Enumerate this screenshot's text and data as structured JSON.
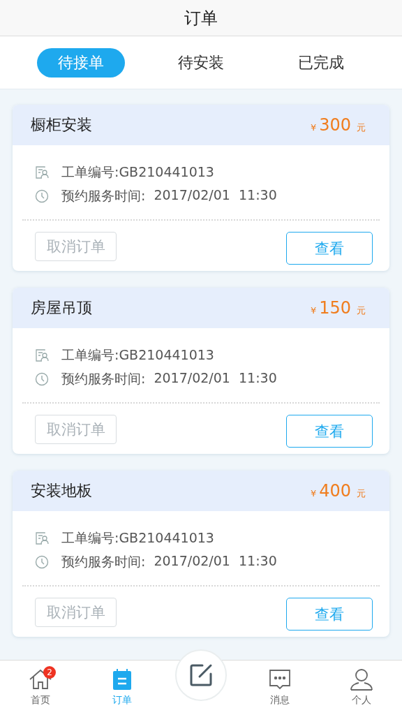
{
  "header": {
    "title": "订单"
  },
  "tabs": [
    {
      "label": "待接单",
      "selected": true
    },
    {
      "label": "待安装",
      "selected": false
    },
    {
      "label": "已完成",
      "selected": false
    }
  ],
  "orders": [
    {
      "title": "橱柜安装",
      "currency": "¥",
      "amount": "300",
      "unit": "元",
      "order_no": "工单编号:GB210441013",
      "time_label": "预约服务时间:",
      "time_value": "2017/02/01  11:30",
      "cancel": "取消订单",
      "cancel_disabled": true,
      "view": "查看"
    },
    {
      "title": "房屋吊顶",
      "currency": "¥",
      "amount": "150",
      "unit": "元",
      "order_no": "工单编号:GB210441013",
      "time_label": "预约服务时间:",
      "time_value": "2017/02/01  11:30",
      "cancel": "取消订单",
      "cancel_disabled": true,
      "view": "查看"
    },
    {
      "title": "安装地板",
      "currency": "¥",
      "amount": "400",
      "unit": "元",
      "order_no": "工单编号:GB210441013",
      "time_label": "预约服务时间:",
      "time_value": "2017/02/01  11:30",
      "cancel": "取消订单",
      "cancel_disabled": true,
      "view": "查看"
    }
  ],
  "nav": [
    {
      "kind": "home",
      "label": "首页",
      "selected": false,
      "badge": "2"
    },
    {
      "kind": "orders",
      "label": "订单",
      "selected": true
    },
    {
      "kind": "compose"
    },
    {
      "kind": "message",
      "label": "消息",
      "selected": false
    },
    {
      "kind": "person",
      "label": "个人",
      "selected": false
    }
  ]
}
